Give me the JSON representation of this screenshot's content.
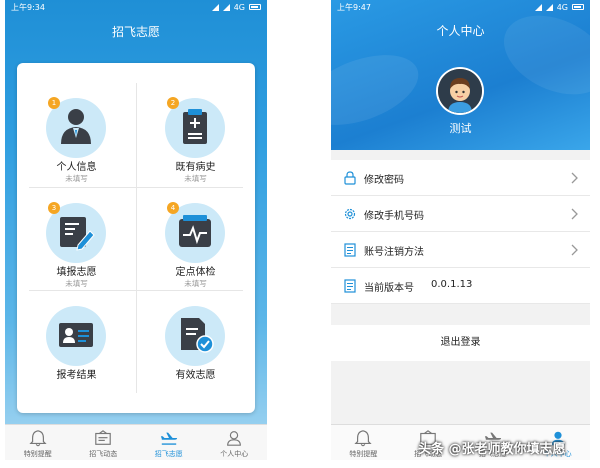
{
  "left": {
    "status": {
      "time": "上午9:34",
      "network": "4G"
    },
    "title": "招飞志愿",
    "tiles": [
      {
        "badge": "1",
        "label": "个人信息",
        "sub": "未填写",
        "icon": "person-icon"
      },
      {
        "badge": "2",
        "label": "既有病史",
        "sub": "未填写",
        "icon": "clipboard-icon"
      },
      {
        "badge": "3",
        "label": "填报志愿",
        "sub": "未填写",
        "icon": "edit-form-icon"
      },
      {
        "badge": "4",
        "label": "定点体检",
        "sub": "未填写",
        "icon": "heartbeat-icon"
      },
      {
        "badge": "",
        "label": "报考结果",
        "sub": "",
        "icon": "id-card-icon"
      },
      {
        "badge": "",
        "label": "有效志愿",
        "sub": "",
        "icon": "verified-doc-icon"
      }
    ],
    "tabs": [
      {
        "label": "特别提醒",
        "icon": "bell-icon",
        "active": false
      },
      {
        "label": "招飞动态",
        "icon": "news-icon",
        "active": false
      },
      {
        "label": "招飞志愿",
        "icon": "airplane-icon",
        "active": true
      },
      {
        "label": "个人中心",
        "icon": "user-icon",
        "active": false
      }
    ],
    "colors": {
      "primary": "#1e90d8",
      "badge": "#f5a623",
      "icon_dark": "#3a3f47"
    }
  },
  "right": {
    "status": {
      "time": "上午9:47",
      "network": "4G"
    },
    "title": "个人中心",
    "username": "测试",
    "menu": [
      {
        "label": "修改密码",
        "icon": "lock-icon",
        "value": "",
        "chevron": true
      },
      {
        "label": "修改手机号码",
        "icon": "gear-icon",
        "value": "",
        "chevron": true
      },
      {
        "label": "账号注销方法",
        "icon": "document-icon",
        "value": "",
        "chevron": true
      },
      {
        "label": "当前版本号",
        "icon": "document-icon",
        "value": "0.0.1.13",
        "chevron": false
      }
    ],
    "logout": "退出登录",
    "tabs": [
      {
        "label": "特别提醒",
        "icon": "bell-icon"
      },
      {
        "label": "招飞动态",
        "icon": "news-icon"
      },
      {
        "label": "招飞志愿",
        "icon": "airplane-icon"
      },
      {
        "label": "个人中心",
        "icon": "user-icon"
      }
    ]
  },
  "watermark": "头条 @张老师教你填志愿"
}
